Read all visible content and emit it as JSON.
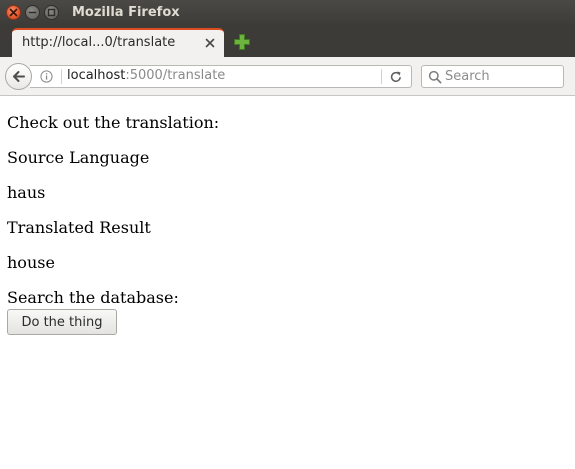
{
  "window": {
    "title": "Mozilla Firefox"
  },
  "tabs": [
    {
      "title": "http://local...0/translate"
    }
  ],
  "navbar": {
    "url_host": "localhost",
    "url_rest": ":5000/translate",
    "search": {
      "placeholder": "Search",
      "value": ""
    }
  },
  "page": {
    "intro": "Check out the translation:",
    "source_label": "Source Language",
    "source_value": "haus",
    "result_label": "Translated Result",
    "result_value": "house",
    "search_label": "Search the database:",
    "button_label": "Do the thing"
  },
  "colors": {
    "titlebar": "#3c3b37",
    "tab_accent": "#d94d20",
    "close_button": "#e4572e",
    "newtab_plus": "#6db33f"
  },
  "icons": [
    "close-icon",
    "minimize-icon",
    "maximize-icon",
    "tab-close-icon",
    "new-tab-icon",
    "back-arrow-icon",
    "info-icon",
    "reload-icon",
    "search-icon"
  ]
}
